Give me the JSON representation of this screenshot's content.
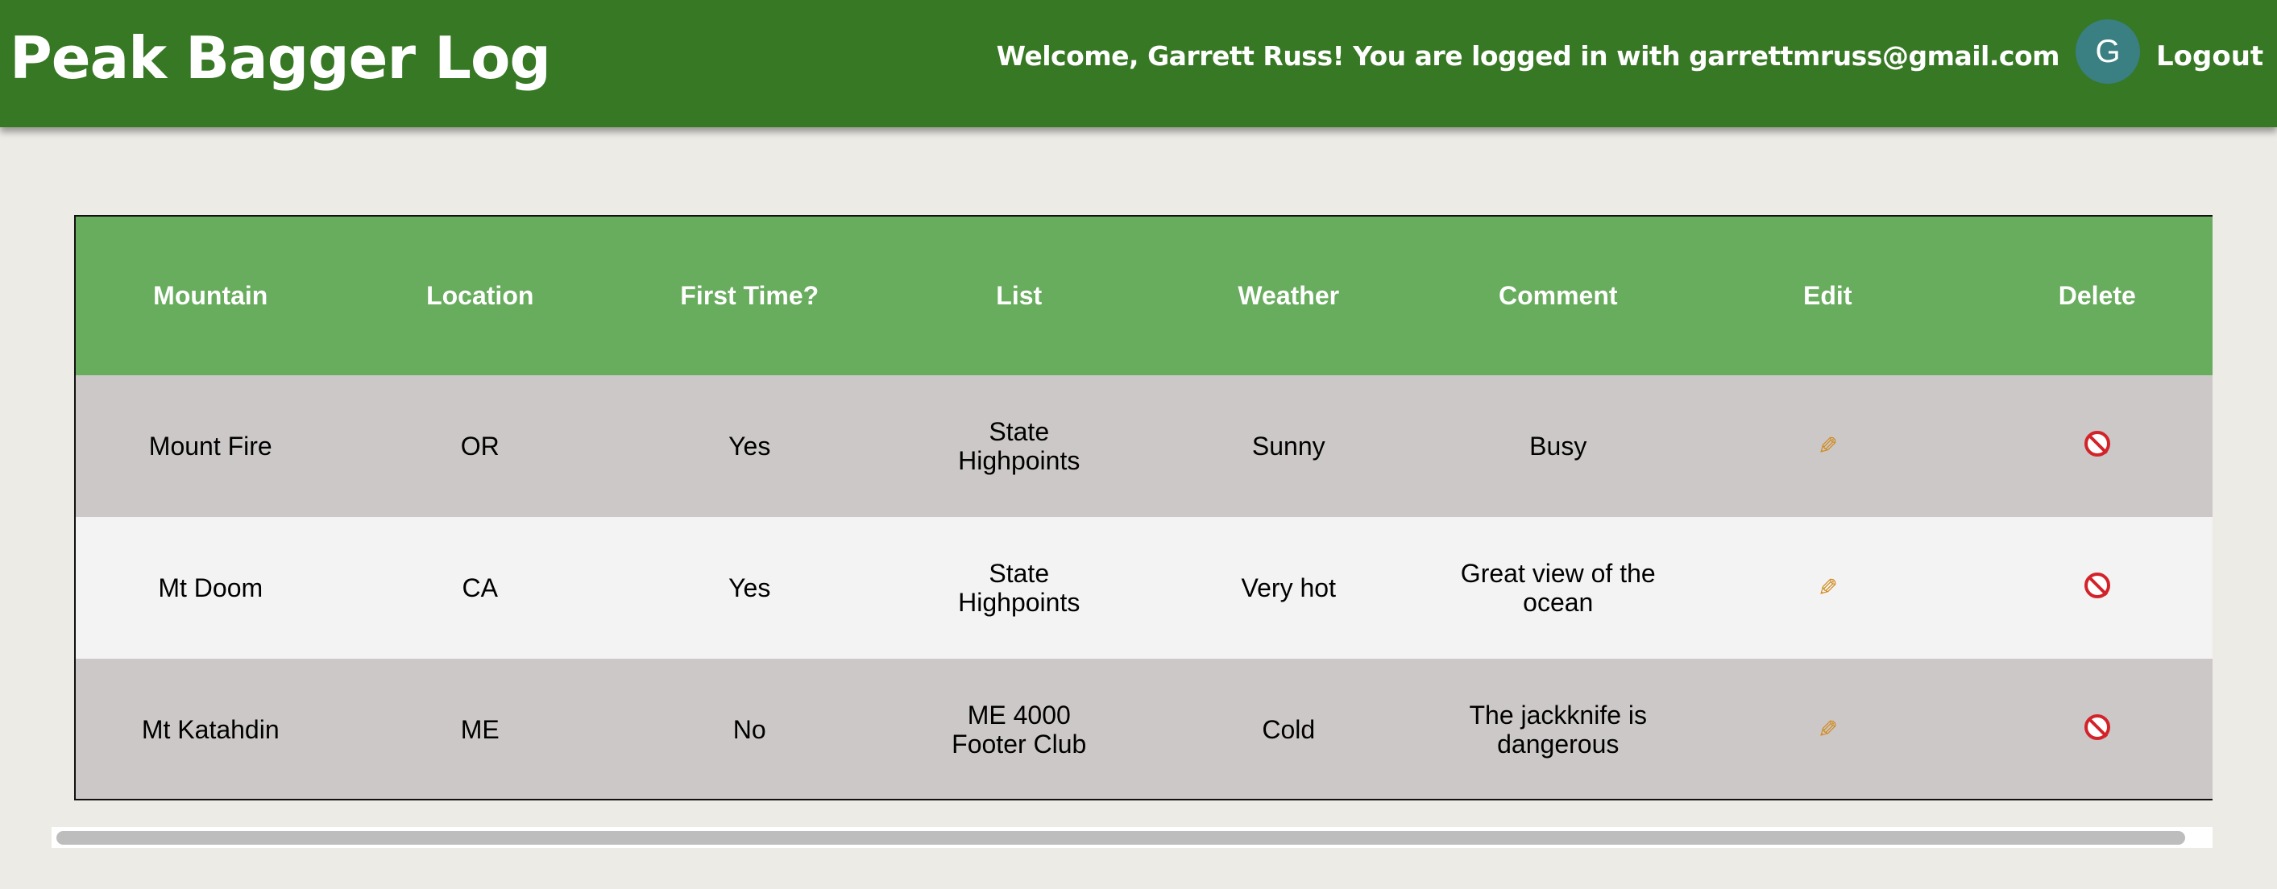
{
  "header": {
    "app_title": "Peak Bagger Log",
    "welcome_text": "Welcome, Garrett Russ! You are logged in with garrettmruss@gmail.com",
    "avatar_initial": "G",
    "logout_label": "Logout",
    "bg_color": "#367823",
    "avatar_color": "#3a7f82"
  },
  "table": {
    "columns": [
      "Mountain",
      "Location",
      "First Time?",
      "List",
      "Weather",
      "Comment",
      "Edit",
      "Delete"
    ],
    "rows": [
      {
        "mountain": "Mount Fire",
        "location": "OR",
        "first_time": "Yes",
        "list": "State Highpoints",
        "weather": "Sunny",
        "comment": "Busy",
        "edit_icon": "pencil-icon",
        "delete_icon": "no-entry-icon"
      },
      {
        "mountain": "Mt Doom",
        "location": "CA",
        "first_time": "Yes",
        "list": "State Highpoints",
        "weather": "Very hot",
        "comment": "Great view of the ocean",
        "edit_icon": "pencil-icon",
        "delete_icon": "no-entry-icon"
      },
      {
        "mountain": "Mt Katahdin",
        "location": "ME",
        "first_time": "No",
        "list": "ME 4000 Footer Club",
        "weather": "Cold",
        "comment": "The jackknife is dangerous",
        "edit_icon": "pencil-icon",
        "delete_icon": "no-entry-icon"
      }
    ],
    "header_color": "#68ac5d",
    "row_odd_color": "#ccc8c7",
    "row_even_color": "#f3f3f3"
  },
  "scrollbar": {
    "horizontal_position": 0.0
  }
}
